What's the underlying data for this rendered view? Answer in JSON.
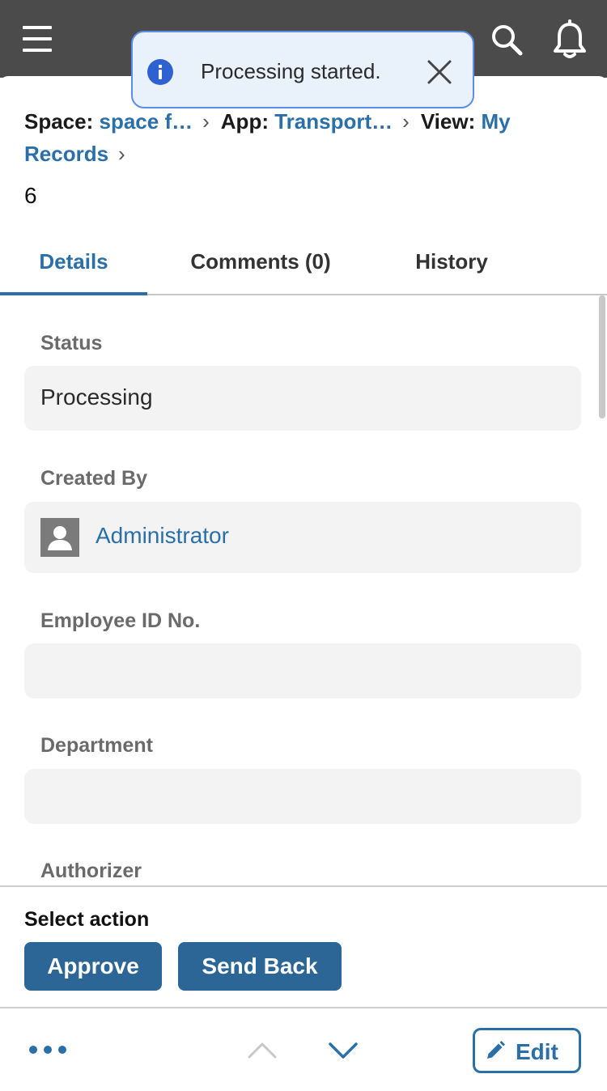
{
  "toast": {
    "message": "Processing started."
  },
  "breadcrumb": {
    "space_label": "Space:",
    "space_value": "space f…",
    "app_label": "App:",
    "app_value": "Transport…",
    "view_label": "View:",
    "view_value": "My Records"
  },
  "record": {
    "number": "6"
  },
  "tabs": [
    {
      "label": "Details",
      "active": true
    },
    {
      "label": "Comments (0)",
      "active": false
    },
    {
      "label": "History",
      "active": false
    }
  ],
  "fields": {
    "status": {
      "label": "Status",
      "value": "Processing"
    },
    "created_by": {
      "label": "Created By",
      "value": "Administrator"
    },
    "employee_id": {
      "label": "Employee ID No.",
      "value": ""
    },
    "department": {
      "label": "Department",
      "value": ""
    },
    "authorizer": {
      "label": "Authorizer"
    }
  },
  "actions": {
    "title": "Select action",
    "approve": "Approve",
    "send_back": "Send Back"
  },
  "footer": {
    "edit_label": "Edit"
  },
  "icons": {
    "menu": "hamburger-icon",
    "search": "search-icon",
    "notifications": "bell-icon",
    "info": "info-icon",
    "close": "close-icon",
    "avatar": "user-icon",
    "more": "more-icon",
    "previous": "chevron-up-icon",
    "next": "chevron-down-icon",
    "edit": "pencil-icon"
  },
  "colors": {
    "header": "#4b4b4b",
    "accent": "#2a6fa8",
    "button": "#2b6696",
    "toast_bg": "#e9f1fb",
    "toast_border": "#5b8ee6",
    "field_bg": "#f3f3f3"
  }
}
